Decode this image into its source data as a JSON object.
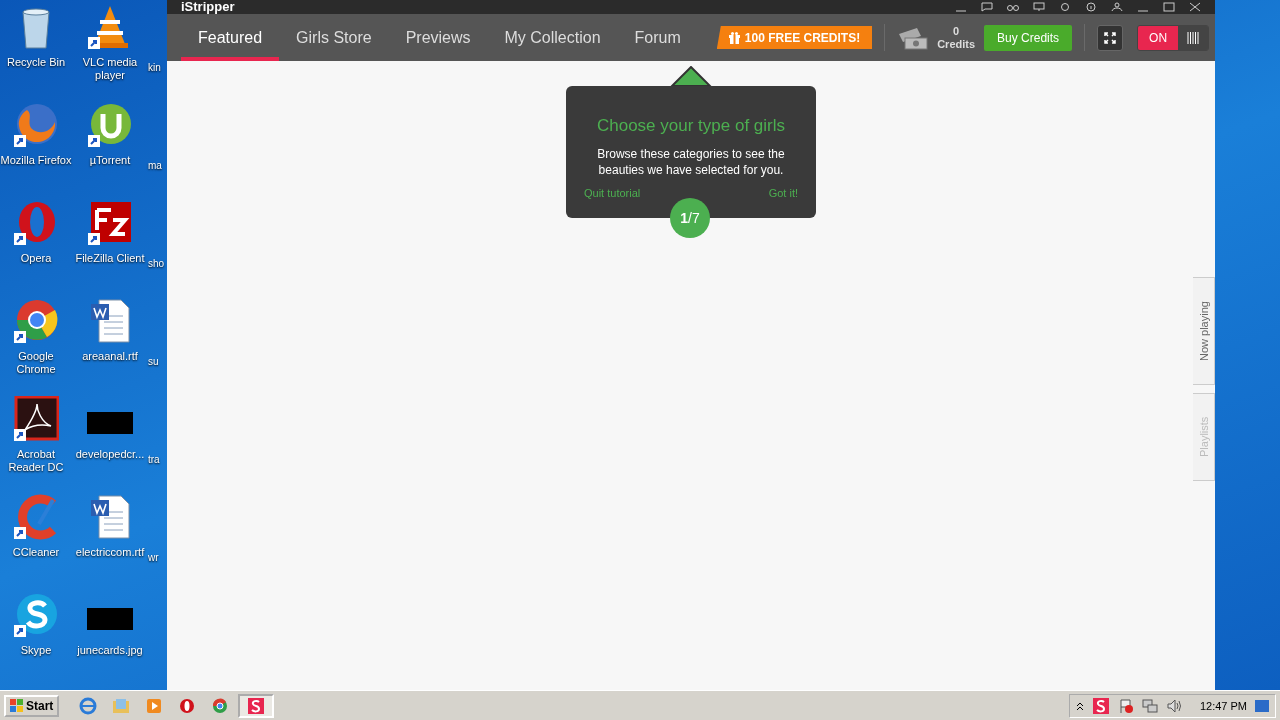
{
  "desktop": {
    "columns": [
      [
        {
          "label": "Recycle Bin",
          "kind": "bin"
        },
        {
          "label": "Mozilla Firefox",
          "kind": "firefox"
        },
        {
          "label": "Opera",
          "kind": "opera"
        },
        {
          "label": "Google Chrome",
          "kind": "chrome"
        },
        {
          "label": "Acrobat Reader DC",
          "kind": "acrobat"
        },
        {
          "label": "CCleaner",
          "kind": "ccleaner"
        },
        {
          "label": "Skype",
          "kind": "skype"
        }
      ],
      [
        {
          "label": "VLC media player",
          "kind": "vlc"
        },
        {
          "label": "µTorrent",
          "kind": "utorrent"
        },
        {
          "label": "FileZilla Client",
          "kind": "filezilla"
        },
        {
          "label": "areaanal.rtf",
          "kind": "word"
        },
        {
          "label": "developedcr...",
          "kind": "hidden"
        },
        {
          "label": "electriccom.rtf",
          "kind": "word"
        },
        {
          "label": "junecards.jpg",
          "kind": "hidden"
        }
      ],
      [
        {
          "label": "kin",
          "kind": "cut"
        },
        {
          "label": "ma",
          "kind": "cut"
        },
        {
          "label": "sho",
          "kind": "cut"
        },
        {
          "label": "su",
          "kind": "cut"
        },
        {
          "label": "tra",
          "kind": "cut"
        },
        {
          "label": "wr",
          "kind": "cut"
        }
      ]
    ]
  },
  "window": {
    "logo": "iStripper",
    "tabs": [
      {
        "label": "Featured",
        "selected": true
      },
      {
        "label": "Girls Store",
        "selected": false
      },
      {
        "label": "Previews",
        "selected": false
      },
      {
        "label": "My Collection",
        "selected": false
      },
      {
        "label": "Forum",
        "selected": false
      }
    ],
    "promo": "100 FREE CREDITS!",
    "credits": {
      "count": "0",
      "label": "Credits"
    },
    "buy_button": "Buy Credits",
    "toggle": {
      "label": "ON",
      "on": true
    },
    "side_tabs": [
      {
        "label": "Now playing",
        "selected": true
      },
      {
        "label": "Playlists",
        "selected": false
      }
    ]
  },
  "tutorial": {
    "title": "Choose your type of girls",
    "body": "Browse these categories to see the beauties we have selected for you.",
    "quit": "Quit tutorial",
    "ok": "Got it!",
    "step": "**1**/7"
  },
  "taskbar": {
    "start": "Start",
    "apps": [
      {
        "kind": "ie",
        "selected": false
      },
      {
        "kind": "folder",
        "selected": false
      },
      {
        "kind": "media",
        "selected": false
      },
      {
        "kind": "opera",
        "selected": false
      },
      {
        "kind": "chrome",
        "selected": false
      },
      {
        "kind": "istripper",
        "selected": true
      }
    ],
    "time": "12:47 PM"
  }
}
